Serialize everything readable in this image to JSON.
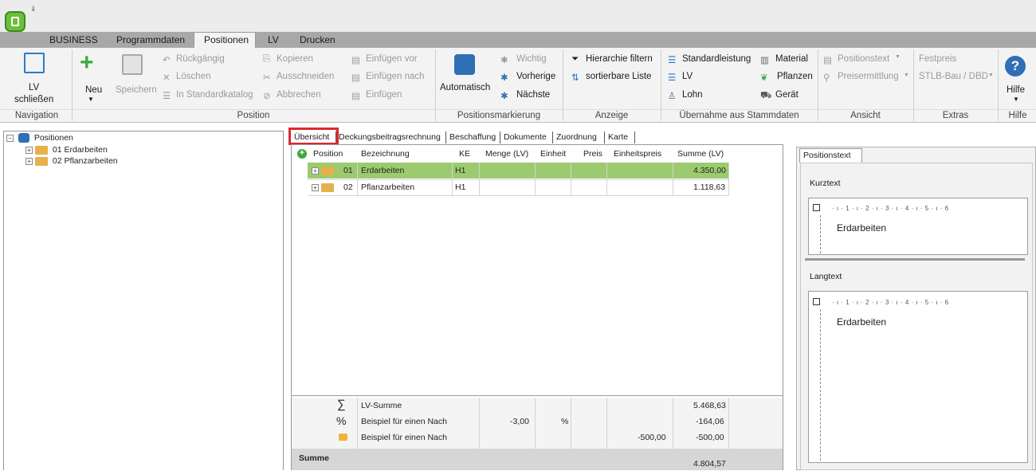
{
  "quickaccess": "⇓",
  "menu": {
    "tabs": [
      "BUSINESS",
      "Programmdaten",
      "Positionen",
      "LV",
      "Drucken"
    ],
    "active": "Positionen"
  },
  "ribbon": {
    "navigation": {
      "lv": "LV",
      "schliessen": "schließen",
      "group": "Navigation"
    },
    "position": {
      "neu": "Neu",
      "speichern": "Speichern",
      "rueckgaengig": "Rückgängig",
      "loeschen": "Löschen",
      "in_standardkatalog": "In Standardkatalog",
      "kopieren": "Kopieren",
      "ausschneiden": "Ausschneiden",
      "abbrechen": "Abbrechen",
      "einfuegen_vor": "Einfügen vor",
      "einfuegen_nach": "Einfügen nach",
      "einfuegen": "Einfügen",
      "group": "Position"
    },
    "markierung": {
      "automatisch": "Automatisch",
      "wichtig": "Wichtig",
      "vorherige": "Vorherige",
      "naechste": "Nächste",
      "group": "Positionsmarkierung"
    },
    "anzeige": {
      "hierarchie": "Hierarchie filtern",
      "sortierbar": "sortierbare Liste",
      "group": "Anzeige"
    },
    "stammdaten": {
      "standardleistung": "Standardleistung",
      "lv": "LV",
      "lohn": "Lohn",
      "material": "Material",
      "pflanzen": "Pflanzen",
      "geraet": "Gerät",
      "group": "Übernahme aus Stammdaten"
    },
    "ansicht": {
      "positionstext": "Positionstext",
      "preisermittlung": "Preisermittlung",
      "group": "Ansicht"
    },
    "extras": {
      "festpreis": "Festpreis",
      "stlb": "STLB-Bau / DBD",
      "group": "Extras"
    },
    "hilfe": {
      "label": "Hilfe",
      "group": "Hilfe"
    }
  },
  "tree": {
    "root": "Positionen",
    "items": [
      "01 Erdarbeiten",
      "02 Pflanzarbeiten"
    ]
  },
  "center_tabs": [
    "Übersicht",
    "Deckungsbeitragsrechnung",
    "Beschaffung",
    "Dokumente",
    "Zuordnung",
    "Karte"
  ],
  "grid": {
    "headers": [
      "Position",
      "Bezeichnung",
      "KE",
      "Menge (LV)",
      "Einheit",
      "Preis",
      "Einheitspreis",
      "Summe (LV)"
    ],
    "rows": [
      {
        "pos": "01",
        "bez": "Erdarbeiten",
        "ke": "H1",
        "summe": "4.350,00"
      },
      {
        "pos": "02",
        "bez": "Pflanzarbeiten",
        "ke": "H1",
        "summe": "1.118,63"
      }
    ],
    "footer": [
      {
        "symbol": "∑",
        "bez": "LV-Summe",
        "menge": "",
        "einheit": "",
        "ep": "",
        "summe": "5.468,63"
      },
      {
        "symbol": "%",
        "bez": "Beispiel für einen Nach",
        "menge": "-3,00",
        "einheit": "%",
        "ep": "",
        "summe": "-164,06"
      },
      {
        "symbol": "lock",
        "bez": "Beispiel für einen Nach",
        "menge": "",
        "einheit": "",
        "ep": "-500,00",
        "summe": "-500,00"
      }
    ],
    "total_label": "Summe",
    "total_value": "4.804,57"
  },
  "right": {
    "tab": "Positionstext",
    "kurztext_label": "Kurztext",
    "kurztext": "Erdarbeiten",
    "langtext_label": "Langtext",
    "langtext": "Erdarbeiten",
    "ruler": "· ı · 1 · ı · 2 · ı · 3 · ı · 4 · ı · 5 · ı · 6"
  },
  "colors": {
    "accent_green": "#9ccb6f",
    "highlight_red": "#e0282e",
    "folder": "#e6b04a"
  }
}
